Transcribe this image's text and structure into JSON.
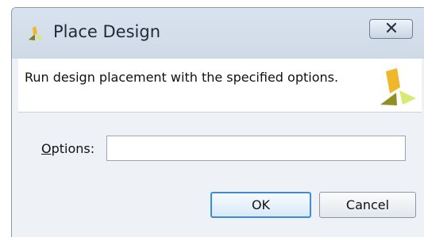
{
  "dialog": {
    "title": "Place Design",
    "description": "Run design placement with the specified options.",
    "options_label_mnemonic": "O",
    "options_label_rest": "ptions:",
    "options_value": "",
    "ok_label": "OK",
    "cancel_label": "Cancel"
  },
  "icons": {
    "title_icon": "vivado-logo-icon",
    "close_icon": "close-icon",
    "header_logo": "vivado-logo-icon"
  },
  "colors": {
    "logo_olive": "#9a9a2c",
    "logo_yellow": "#f1b72b",
    "logo_light": "#d9ea72",
    "focus_border": "#3e8bd8"
  }
}
